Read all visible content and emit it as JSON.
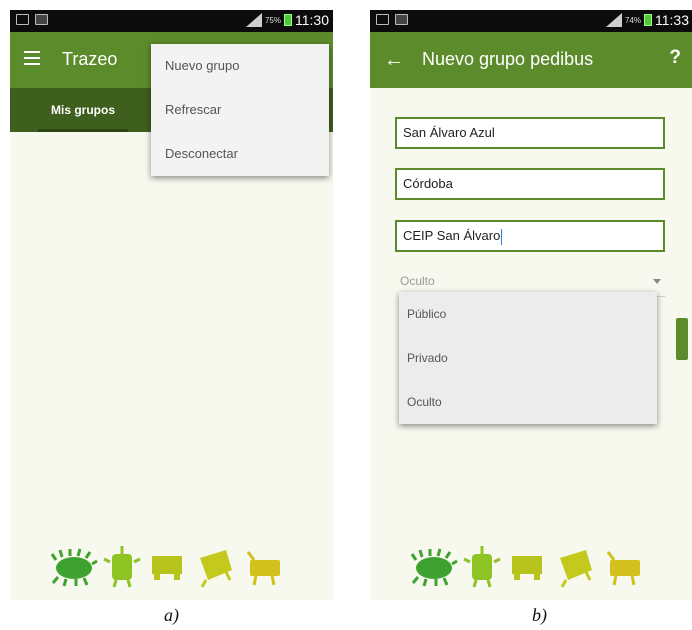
{
  "screen_a": {
    "status_bar": {
      "battery_pct": "75%",
      "time": "11:30"
    },
    "app_title": "Trazeo",
    "tab": "Mis grupos",
    "menu_items": [
      "Nuevo grupo",
      "Refrescar",
      "Desconectar"
    ]
  },
  "screen_b": {
    "status_bar": {
      "battery_pct": "74%",
      "time": "11:33"
    },
    "title": "Nuevo grupo pedibus",
    "help": "?",
    "fields": [
      "San Álvaro Azul",
      "Córdoba",
      "CEIP San Álvaro"
    ],
    "visibility_selected": "Oculto",
    "visibility_options": [
      "Público",
      "Privado",
      "Oculto"
    ]
  },
  "captions": {
    "a": "a)",
    "b": "b)"
  },
  "colors": {
    "app_bar": "#5c8b2b",
    "tab_bar": "#3e5f1d",
    "mascot_green": "#3fa12f",
    "mascot_yellow": "#b7c41c"
  }
}
